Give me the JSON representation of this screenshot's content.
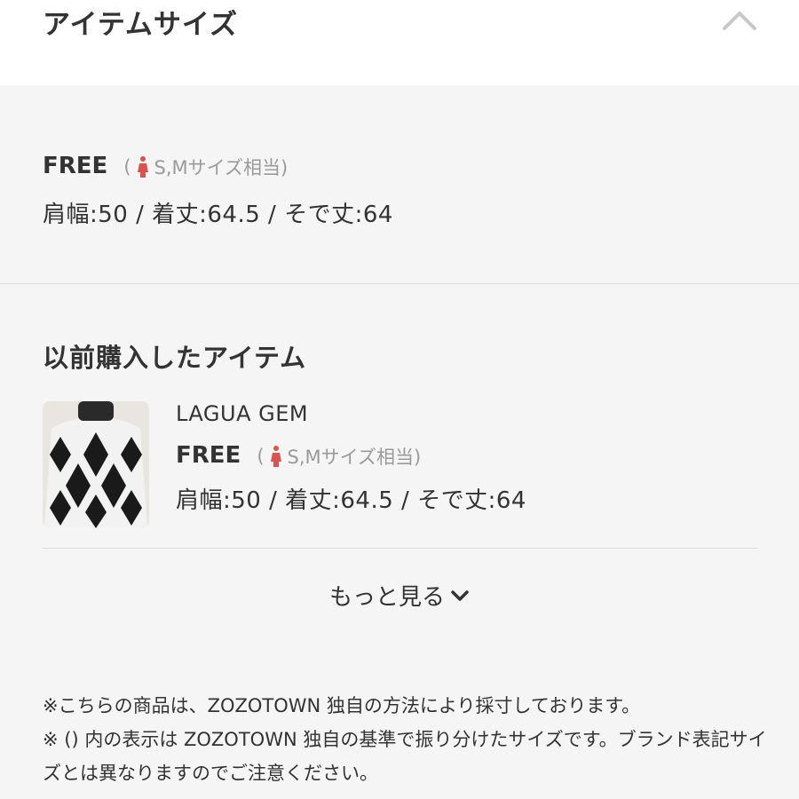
{
  "header": {
    "title": "アイテムサイズ",
    "toggle_icon": "chevron-up-icon"
  },
  "size": {
    "label": "FREE",
    "hint_open": "(",
    "hint_text": "S,Mサイズ相当)",
    "hint_icon": "woman-icon",
    "measurements": "肩幅:50 / 着丈:64.5 / そで丈:64"
  },
  "previous": {
    "title": "以前購入したアイテム",
    "items": [
      {
        "brand": "LAGUA GEM",
        "size_label": "FREE",
        "hint_open": "(",
        "hint_text": "S,Mサイズ相当)",
        "measurements": "肩幅:50 / 着丈:64.5 / そで丈:64"
      }
    ],
    "more_label": "もっと見る"
  },
  "notes": [
    "※こちらの商品は、ZOZOTOWN 独自の方法により採寸しております。",
    "※ () 内の表示は ZOZOTOWN 独自の基準で振り分けたサイズです。ブランド表記サイズとは異なりますのでご注意ください。"
  ],
  "colors": {
    "accent_icon": "#d9534f",
    "text": "#333333",
    "muted": "#9a9a9a",
    "background": "#f5f5f5"
  }
}
